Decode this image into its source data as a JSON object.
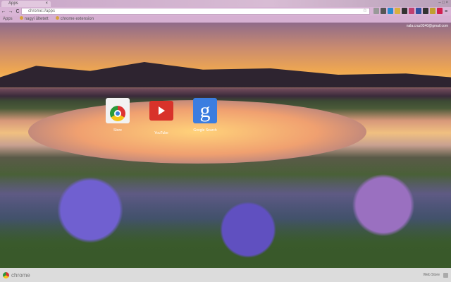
{
  "tab": {
    "title": "Apps",
    "close": "×"
  },
  "window": {
    "controls": "–  □  ×"
  },
  "toolbar": {
    "back": "←",
    "forward": "→",
    "reload": "C",
    "url": "chrome://apps",
    "star": "☆",
    "menu": "≡"
  },
  "bookmarks": [
    {
      "label": "Apps"
    },
    {
      "label": "nagyi ültetett"
    },
    {
      "label": "chrome extension"
    }
  ],
  "user": {
    "email": "nala.cruz0340@gmail.com"
  },
  "apps": [
    {
      "label": "Store"
    },
    {
      "label": "YouTube"
    },
    {
      "label": "Google Search",
      "glyph": "g"
    }
  ],
  "footer": {
    "brand": "chrome",
    "webstore": "Web Store"
  },
  "extensions": [
    "#999",
    "#555",
    "#2a8ad0",
    "#d9b040",
    "#333",
    "#c04070",
    "#3050a0",
    "#333",
    "#c0a030",
    "#d02050"
  ]
}
